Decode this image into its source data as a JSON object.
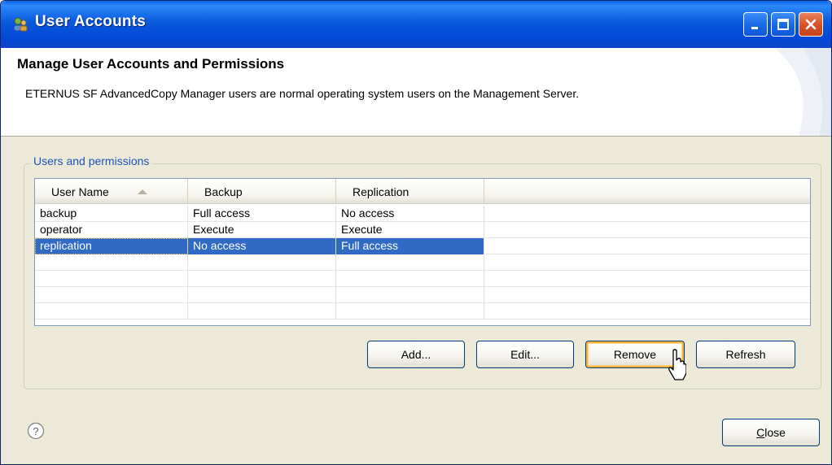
{
  "window": {
    "title": "User Accounts"
  },
  "header": {
    "title": "Manage User Accounts and Permissions",
    "description": "ETERNUS SF AdvancedCopy Manager users are normal operating system users on the Management Server."
  },
  "group": {
    "label": "Users and permissions"
  },
  "table": {
    "columns": [
      "User Name",
      "Backup",
      "Replication"
    ],
    "sort_column": "User Name",
    "sort_direction": "ascending",
    "rows": [
      {
        "user": "backup",
        "backup": "Full access",
        "replication": "No access",
        "selected": false
      },
      {
        "user": "operator",
        "backup": "Execute",
        "replication": "Execute",
        "selected": false
      },
      {
        "user": "replication",
        "backup": "No access",
        "replication": "Full access",
        "selected": true
      }
    ]
  },
  "buttons": {
    "add": "Add...",
    "edit": "Edit...",
    "remove": "Remove",
    "refresh": "Refresh",
    "close": "Close"
  },
  "colors": {
    "titlebar": "#0a58dd",
    "selection": "#316ac5",
    "group_label": "#1c54b4",
    "dialog_bg": "#ece9d8"
  },
  "icons": {
    "app": "app-icon",
    "help": "help-icon",
    "minimize": "minimize-icon",
    "maximize": "maximize-icon",
    "close": "close-icon"
  }
}
